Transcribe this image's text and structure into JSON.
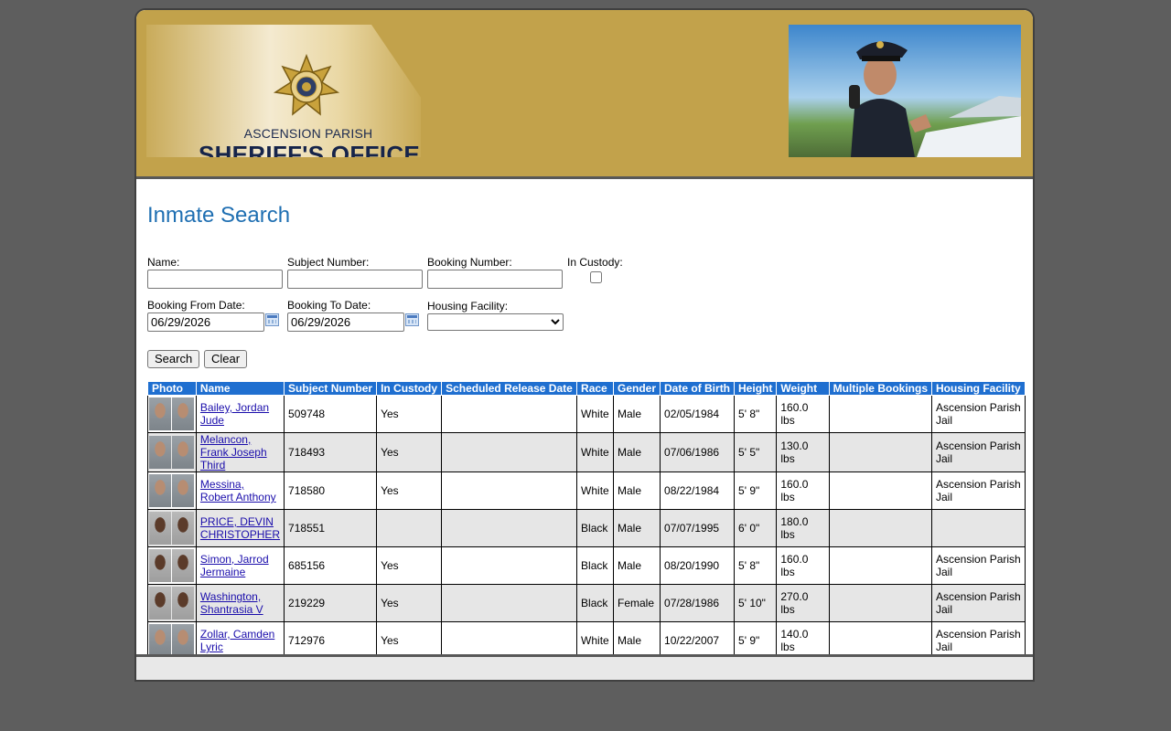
{
  "header": {
    "org_line1": "ASCENSION PARISH",
    "org_line2": "SHERIFF'S OFFICE"
  },
  "page_title": "Inmate Search",
  "form": {
    "name_label": "Name:",
    "name_value": "",
    "subject_label": "Subject Number:",
    "subject_value": "",
    "booking_label": "Booking Number:",
    "booking_value": "",
    "custody_label": "In Custody:",
    "custody_checked": false,
    "from_label": "Booking From Date:",
    "from_value": "06/29/2026",
    "to_label": "Booking To Date:",
    "to_value": "06/29/2026",
    "facility_label": "Housing Facility:",
    "facility_value": "",
    "search_label": "Search",
    "clear_label": "Clear"
  },
  "table": {
    "headers": [
      "Photo",
      "Name",
      "Subject Number",
      "In Custody",
      "Scheduled Release Date",
      "Race",
      "Gender",
      "Date of Birth",
      "Height",
      "Weight",
      "Multiple Bookings",
      "Housing Facility"
    ],
    "rows": [
      {
        "name": "Bailey, Jordan Jude",
        "subject": "509748",
        "custody": "Yes",
        "release": "",
        "race": "White",
        "gender": "Male",
        "dob": "02/05/1984",
        "height": "5' 8\"",
        "weight": "160.0 lbs",
        "multiple": "",
        "facility": "Ascension Parish Jail"
      },
      {
        "name": "Melancon, Frank Joseph Third",
        "subject": "718493",
        "custody": "Yes",
        "release": "",
        "race": "White",
        "gender": "Male",
        "dob": "07/06/1986",
        "height": "5' 5\"",
        "weight": "130.0 lbs",
        "multiple": "",
        "facility": "Ascension Parish Jail"
      },
      {
        "name": "Messina, Robert Anthony",
        "subject": "718580",
        "custody": "Yes",
        "release": "",
        "race": "White",
        "gender": "Male",
        "dob": "08/22/1984",
        "height": "5' 9\"",
        "weight": "160.0 lbs",
        "multiple": "",
        "facility": "Ascension Parish Jail"
      },
      {
        "name": "PRICE, DEVIN CHRISTOPHER",
        "subject": "718551",
        "custody": "",
        "release": "",
        "race": "Black",
        "gender": "Male",
        "dob": "07/07/1995",
        "height": "6' 0\"",
        "weight": "180.0 lbs",
        "multiple": "",
        "facility": ""
      },
      {
        "name": "Simon, Jarrod Jermaine",
        "subject": "685156",
        "custody": "Yes",
        "release": "",
        "race": "Black",
        "gender": "Male",
        "dob": "08/20/1990",
        "height": "5' 8\"",
        "weight": "160.0 lbs",
        "multiple": "",
        "facility": "Ascension Parish Jail"
      },
      {
        "name": "Washington, Shantrasia V",
        "subject": "219229",
        "custody": "Yes",
        "release": "",
        "race": "Black",
        "gender": "Female",
        "dob": "07/28/1986",
        "height": "5' 10\"",
        "weight": "270.0 lbs",
        "multiple": "",
        "facility": "Ascension Parish Jail"
      },
      {
        "name": "Zollar, Camden Lyric",
        "subject": "712976",
        "custody": "Yes",
        "release": "",
        "race": "White",
        "gender": "Male",
        "dob": "10/22/2007",
        "height": "5' 9\"",
        "weight": "140.0 lbs",
        "multiple": "",
        "facility": "Ascension Parish Jail"
      }
    ]
  },
  "colors": {
    "banner": "#c2a24b",
    "title": "#1f6fb2",
    "table_header": "#1f6fd0",
    "page_bg": "#5e5e5e"
  }
}
